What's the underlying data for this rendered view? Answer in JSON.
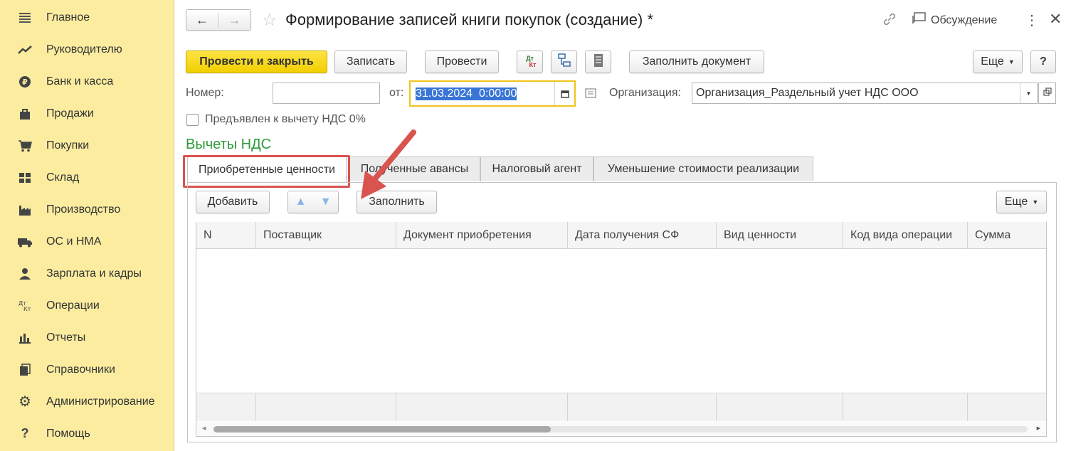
{
  "sidebar": {
    "items": [
      {
        "label": "Главное",
        "icon": "menu-icon"
      },
      {
        "label": "Руководителю",
        "icon": "trend-icon"
      },
      {
        "label": "Банк и касса",
        "icon": "ruble-icon"
      },
      {
        "label": "Продажи",
        "icon": "bag-icon"
      },
      {
        "label": "Покупки",
        "icon": "cart-icon"
      },
      {
        "label": "Склад",
        "icon": "warehouse-icon"
      },
      {
        "label": "Производство",
        "icon": "factory-icon"
      },
      {
        "label": "ОС и НМА",
        "icon": "truck-icon"
      },
      {
        "label": "Зарплата и кадры",
        "icon": "person-icon"
      },
      {
        "label": "Операции",
        "icon": "dt-kt-icon"
      },
      {
        "label": "Отчеты",
        "icon": "bar-chart-icon"
      },
      {
        "label": "Справочники",
        "icon": "books-icon"
      },
      {
        "label": "Администрирование",
        "icon": "gear-icon"
      },
      {
        "label": "Помощь",
        "icon": "help-icon"
      }
    ]
  },
  "header": {
    "title": "Формирование записей книги покупок (создание) *",
    "discussion": "Обсуждение"
  },
  "toolbar": {
    "post_close": "Провести и закрыть",
    "save": "Записать",
    "post": "Провести",
    "fill_doc": "Заполнить документ",
    "more": "Еще",
    "help": "?",
    "dt_kt_top": "Дт",
    "dt_kt_bottom": "Кт"
  },
  "form": {
    "number_label": "Номер:",
    "number_value": "",
    "date_label": "от:",
    "date_value": "31.03.2024  0:00:00",
    "org_label": "Организация:",
    "org_value": "Организация_Раздельный учет НДС ООО",
    "checkbox_label": "Предъявлен к вычету НДС 0%",
    "checkbox_checked": false
  },
  "section_title": "Вычеты НДС",
  "tabs": [
    {
      "label": "Приобретенные ценности",
      "active": true
    },
    {
      "label": "Полученные авансы",
      "active": false
    },
    {
      "label": "Налоговый агент",
      "active": false
    },
    {
      "label": "Уменьшение стоимости реализации",
      "active": false
    }
  ],
  "tab_toolbar": {
    "add": "Добавить",
    "fill": "Заполнить",
    "more": "Еще"
  },
  "table": {
    "columns": [
      "N",
      "Поставщик",
      "Документ приобретения",
      "Дата получения СФ",
      "Вид ценности",
      "Код вида операции",
      "Сумма"
    ],
    "rows": []
  },
  "colors": {
    "sidebar_bg": "#fbeca0",
    "primary_button": "#f5d416",
    "section_title": "#2e9a3a",
    "highlight": "#d9534f",
    "date_focus": "#f0c419"
  }
}
